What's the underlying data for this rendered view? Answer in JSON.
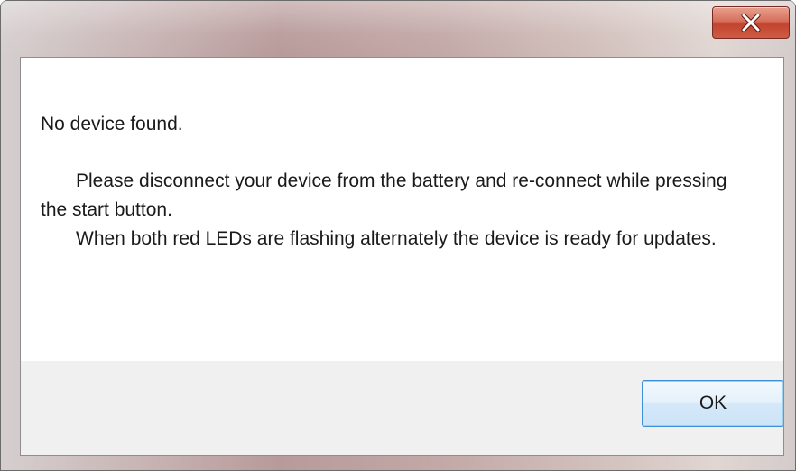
{
  "window": {
    "close_icon": "close-icon"
  },
  "message": {
    "title": "No device found.",
    "paragraph1": "Please disconnect your device from the battery and re-connect while pressing the start button.",
    "paragraph2": "When both red LEDs are flashing alternately the device is ready for updates."
  },
  "buttons": {
    "ok_label": "OK"
  },
  "colors": {
    "close_button": "#c8452f",
    "ok_border": "#3c8fd9",
    "footer_bg": "#f0f0f0"
  }
}
